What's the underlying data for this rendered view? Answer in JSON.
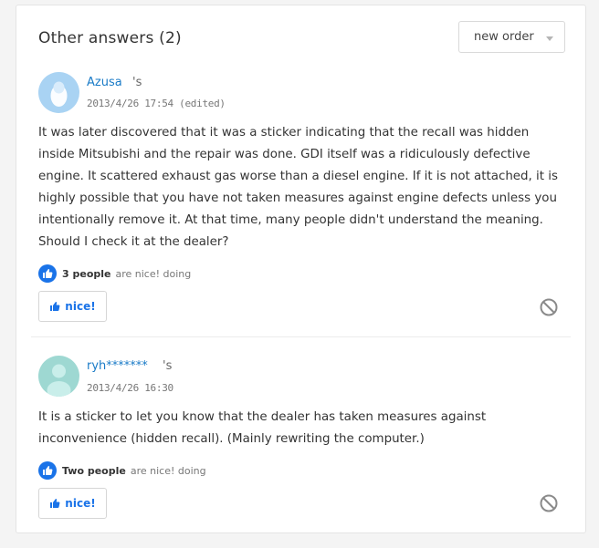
{
  "header": {
    "title": "Other answers (2)",
    "sort_select": {
      "selected": "new order"
    }
  },
  "answers": [
    {
      "username": "Azusa",
      "honorific": "'s",
      "timestamp": "2013/4/26 17:54 (edited)",
      "body": "It was later discovered that it was a sticker indicating that the recall was hidden inside Mitsubishi and the repair was done. GDI itself was a ridiculously defective engine. It scattered exhaust gas worse than a diesel engine. If it is not attached, it is highly possible that you have not taken measures against engine defects unless you intentionally remove it. At that time, many people didn't understand the meaning. Should I check it at the dealer?",
      "likes_count": "3 people",
      "likes_suffix": "are nice! doing",
      "nice_label": "nice!",
      "avatar_color": "#a9d3f3"
    },
    {
      "username": "ryh*******",
      "honorific": "'s",
      "timestamp": "2013/4/26 16:30",
      "body": "It is a sticker to let you know that the dealer has taken measures against inconvenience (hidden recall). (Mainly rewriting the computer.)",
      "likes_count": "Two people",
      "likes_suffix": "are nice! doing",
      "nice_label": "nice!",
      "avatar_color": "#9ed8d2"
    }
  ],
  "icons": {
    "sort_caret": "chevron-down-icon",
    "like": "thumbs-up-icon",
    "report": "prohibited-icon"
  },
  "colors": {
    "accent": "#1a73e8",
    "username": "#1a7bc7"
  }
}
